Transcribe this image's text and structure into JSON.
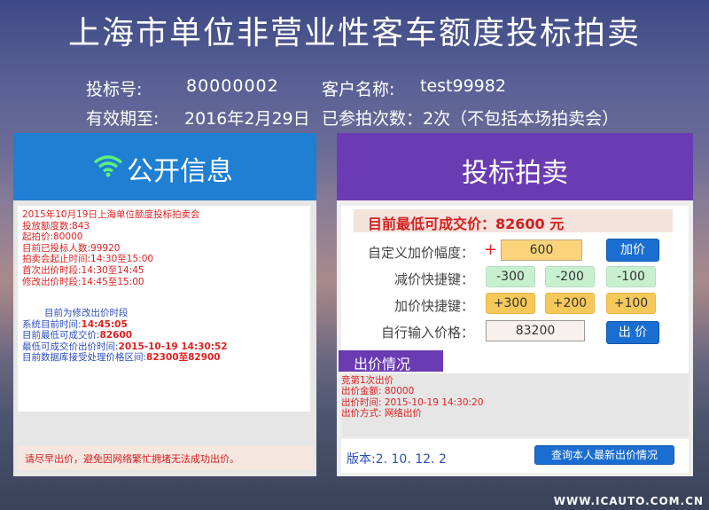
{
  "header": {
    "title": "上海市单位非营业性客车额度投标拍卖",
    "bid_no_label": "投标号:",
    "bid_no": "80000002",
    "client_label": "客户名称:",
    "client": "test99982",
    "valid_label": "有效期至:",
    "valid_date": "2016年2月29日",
    "count_text": "已参拍次数：2次（不包括本场拍卖会）"
  },
  "public_info": {
    "title": "公开信息",
    "lines_red": [
      "2015年10月19日上海单位额度投标拍卖会",
      "投放额度数:843",
      "起拍价:80000",
      "目前已投标人数:99920",
      "拍卖会起止时间:14:30至15:00",
      "首次出价时段:14:30至14:45",
      "修改出价时段:14:45至15:00"
    ],
    "phase": "目前为修改出价时段",
    "system_time_label": "系统目前时间:",
    "system_time": "14:45:05",
    "lowest_price_label": "目前最低可成交价:",
    "lowest_price": "82600",
    "lowest_time_label": "最低可成交价出价时间:",
    "lowest_time": "2015-10-19 14:30:52",
    "range_label": "目前数据库接受处理价格区间:",
    "range": "82300至82900",
    "footer_notice": "请尽早出价，避免因网络繁忙拥堵无法成功出价。"
  },
  "bidding": {
    "title": "投标拍卖",
    "lowest_price": "目前最低可成交价：82600 元",
    "custom_label": "自定义加价幅度：",
    "plus_sign": "+",
    "custom_value": "600",
    "add_button": "加价",
    "minus_label": "减价快捷键：",
    "minus_buttons": [
      "-300",
      "-200",
      "-100"
    ],
    "plus_label": "加价快捷键：",
    "plus_buttons": [
      "+300",
      "+200",
      "+100"
    ],
    "manual_label": "自行输入价格：",
    "manual_value": "83200",
    "bid_button": "出 价",
    "status_title": "出价情况",
    "status_lines": [
      "竞第1次出价",
      "出价金额: 80000",
      "出价时间: 2015-10-19 14:30:20",
      "出价方式: 网络出价"
    ],
    "version": "版本:2. 10. 12. 2",
    "query_button": "查询本人最新出价情况"
  },
  "watermark": "WWW.ICAUTO.COM.CN"
}
